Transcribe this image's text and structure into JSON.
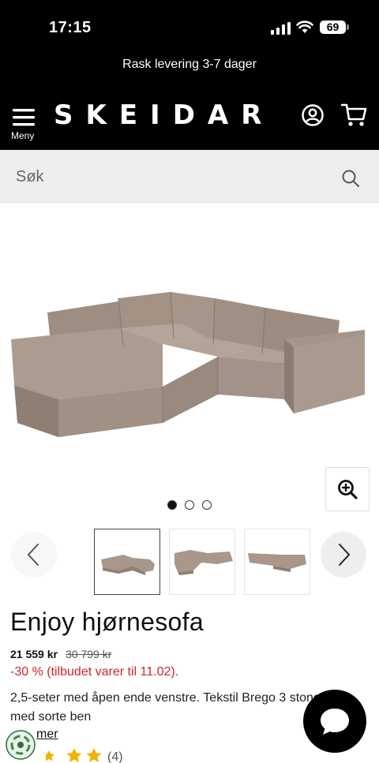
{
  "status_bar": {
    "time": "17:15",
    "battery": "69"
  },
  "promo": {
    "text": "Rask levering 3-7 dager"
  },
  "header": {
    "menu_label": "Meny",
    "logo": "SKEIDAR"
  },
  "search": {
    "placeholder": "Søk"
  },
  "gallery": {
    "image_count": 3,
    "active_index": 0
  },
  "product": {
    "title": "Enjoy hjørnesofa",
    "price": "21 559 kr",
    "old_price": "30 799 kr",
    "discount": "-30 % (tilbudet varer til 11.02).",
    "description": "2,5-seter med åpen ende venstre. Tekstil Brego 3 stone med sorte ben",
    "read_more": "mer",
    "rating": 5,
    "review_count": "(4)"
  },
  "colors": {
    "header_bg": "#000000",
    "discount": "#d2232a",
    "star": "#f2b400",
    "sofa": "#a8978a"
  }
}
